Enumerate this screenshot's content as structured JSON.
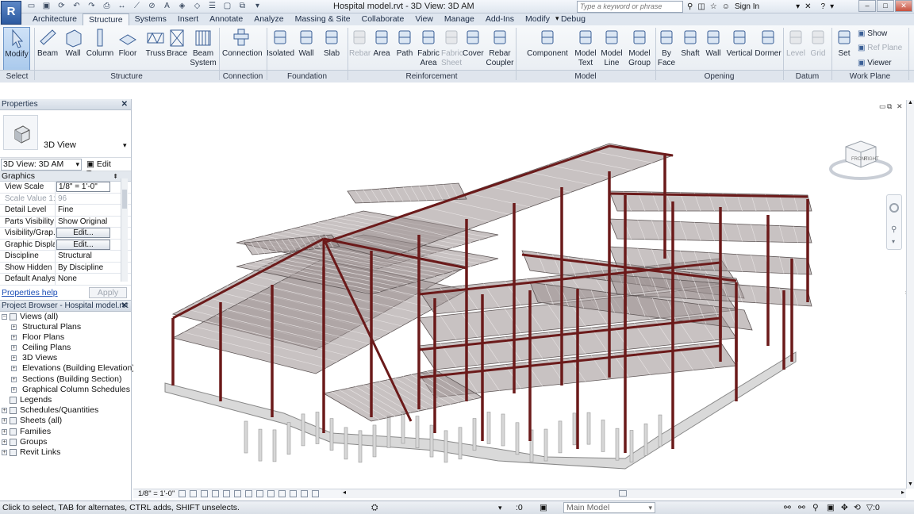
{
  "app": {
    "logo": "R",
    "title": "Hospital model.rvt - 3D View: 3D AM"
  },
  "search": {
    "placeholder": "Type a keyword or phrase"
  },
  "account": {
    "sign_in": "Sign In"
  },
  "tabs": [
    "Architecture",
    "Structure",
    "Systems",
    "Insert",
    "Annotate",
    "Analyze",
    "Massing & Site",
    "Collaborate",
    "View",
    "Manage",
    "Add-Ins",
    "Modify",
    "Debug"
  ],
  "active_tab": "Structure",
  "ribbon": {
    "buttons": [
      {
        "label": "Modify",
        "icon": "modify-arrow-icon"
      },
      {
        "label": "Beam",
        "icon": "beam-icon"
      },
      {
        "label": "Wall",
        "icon": "wall-icon"
      },
      {
        "label": "Column",
        "icon": "column-icon"
      },
      {
        "label": "Floor",
        "icon": "floor-icon"
      },
      {
        "label": "Truss",
        "icon": "truss-icon"
      },
      {
        "label": "Brace",
        "icon": "brace-icon"
      },
      {
        "label": "Beam\nSystem",
        "icon": "beam-system-icon"
      },
      {
        "label": "Connection",
        "icon": "connection-icon"
      },
      {
        "label": "Isolated",
        "icon": "isolated-footing-icon"
      },
      {
        "label": "Wall",
        "icon": "wall-foundation-icon"
      },
      {
        "label": "Slab",
        "icon": "slab-icon"
      },
      {
        "label": "Rebar",
        "icon": "rebar-icon"
      },
      {
        "label": "Area",
        "icon": "area-icon"
      },
      {
        "label": "Path",
        "icon": "path-icon"
      },
      {
        "label": "Fabric\nArea",
        "icon": "fabric-area-icon"
      },
      {
        "label": "Fabric\nSheet",
        "icon": "fabric-sheet-icon"
      },
      {
        "label": "Cover",
        "icon": "cover-icon"
      },
      {
        "label": "Rebar\nCoupler",
        "icon": "rebar-coupler-icon"
      },
      {
        "label": "Component",
        "icon": "component-icon"
      },
      {
        "label": "Model\nText",
        "icon": "model-text-icon"
      },
      {
        "label": "Model\nLine",
        "icon": "model-line-icon"
      },
      {
        "label": "Model\nGroup",
        "icon": "model-group-icon"
      },
      {
        "label": "By\nFace",
        "icon": "by-face-icon"
      },
      {
        "label": "Shaft",
        "icon": "shaft-icon"
      },
      {
        "label": "Wall",
        "icon": "wall-opening-icon"
      },
      {
        "label": "Vertical",
        "icon": "vertical-opening-icon"
      },
      {
        "label": "Dormer",
        "icon": "dormer-icon"
      },
      {
        "label": "Level",
        "icon": "level-icon"
      },
      {
        "label": "Grid",
        "icon": "grid-icon"
      },
      {
        "label": "Set",
        "icon": "set-workplane-icon"
      }
    ],
    "workplane_small": [
      "Show",
      "Ref  Plane",
      "Viewer"
    ],
    "groups": [
      "Select",
      "Structure",
      "Connection",
      "Foundation",
      "Reinforcement",
      "Model",
      "Opening",
      "Datum",
      "Work Plane"
    ]
  },
  "properties": {
    "title": "Properties",
    "type_name": "3D View",
    "view_selector": "3D View: 3D AM",
    "edit_type": "Edit Type",
    "group": "Graphics",
    "rows": [
      {
        "k": "View Scale",
        "v": "1/8\" = 1'-0\""
      },
      {
        "k": "Scale Value    1:",
        "v": "96"
      },
      {
        "k": "Detail Level",
        "v": "Fine"
      },
      {
        "k": "Parts Visibility",
        "v": "Show Original"
      },
      {
        "k": "Visibility/Grap...",
        "v": "Edit..."
      },
      {
        "k": "Graphic Displa...",
        "v": "Edit..."
      },
      {
        "k": "Discipline",
        "v": "Structural"
      },
      {
        "k": "Show Hidden ...",
        "v": "By Discipline"
      },
      {
        "k": "Default Analys...",
        "v": "None"
      }
    ],
    "help": "Properties help",
    "apply": "Apply"
  },
  "browser": {
    "title": "Project Browser - Hospital model.rvt",
    "items": [
      {
        "label": "Views (all)",
        "level": 0,
        "pm": "−"
      },
      {
        "label": "Structural Plans",
        "level": 1,
        "pm": "+"
      },
      {
        "label": "Floor Plans",
        "level": 1,
        "pm": "+"
      },
      {
        "label": "Ceiling Plans",
        "level": 1,
        "pm": "+"
      },
      {
        "label": "3D Views",
        "level": 1,
        "pm": "+"
      },
      {
        "label": "Elevations (Building Elevation)",
        "level": 1,
        "pm": "+"
      },
      {
        "label": "Sections (Building Section)",
        "level": 1,
        "pm": "+"
      },
      {
        "label": "Graphical Column Schedules",
        "level": 1,
        "pm": "+"
      },
      {
        "label": "Legends",
        "level": 0,
        "pm": ""
      },
      {
        "label": "Schedules/Quantities",
        "level": 0,
        "pm": "+"
      },
      {
        "label": "Sheets (all)",
        "level": 0,
        "pm": "+"
      },
      {
        "label": "Families",
        "level": 0,
        "pm": "+"
      },
      {
        "label": "Groups",
        "level": 0,
        "pm": "+"
      },
      {
        "label": "Revit Links",
        "level": 0,
        "pm": "+"
      }
    ]
  },
  "viewcube": {
    "front": "FRONT",
    "right": "RIGHT"
  },
  "view_control": {
    "scale": "1/8\" = 1'-0\""
  },
  "status": {
    "message": "Click to select, TAB for alternates, CTRL adds, SHIFT unselects.",
    "zero": ":0",
    "model": "Main Model"
  },
  "colors": {
    "steel": "#6b1a1a",
    "slab": "#9a9090",
    "ribbon_bg": "#e6ebf1"
  }
}
